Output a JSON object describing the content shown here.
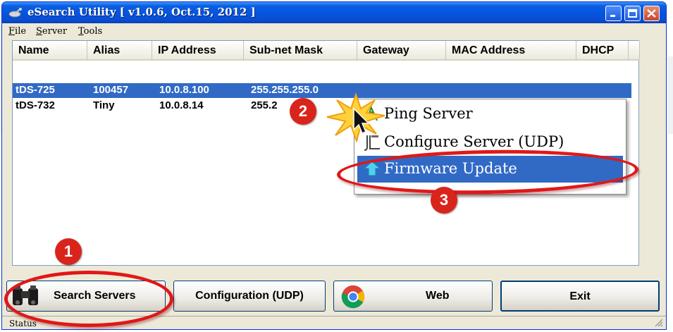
{
  "window": {
    "title": "eSearch Utility [ v1.0.6, Oct.15, 2012 ]",
    "icon": "satellite-dish-icon"
  },
  "menu": [
    {
      "label": "File",
      "accel": "F",
      "rest": "ile"
    },
    {
      "label": "Server",
      "accel": "S",
      "rest": "erver"
    },
    {
      "label": "Tools",
      "accel": "T",
      "rest": "ools"
    }
  ],
  "columns": [
    "Name",
    "Alias",
    "IP Address",
    "Sub-net Mask",
    "Gateway",
    "MAC Address",
    "DHCP"
  ],
  "rows": [
    {
      "name": "tDS-725",
      "alias": "100457",
      "ip": "10.0.8.100",
      "mask": "255.255.255.0",
      "gateway": "",
      "mac": "",
      "dhcp": "",
      "selected": true
    },
    {
      "name": "tDS-732",
      "alias": "Tiny",
      "ip": "10.0.8.14",
      "mask": "255.2",
      "gateway": "",
      "mac": "",
      "dhcp": "",
      "selected": false
    }
  ],
  "context_menu": {
    "items": [
      {
        "label": "Ping Server",
        "icon": "ping-icon"
      },
      {
        "label": "Configure Server (UDP)",
        "icon": "configure-icon"
      },
      {
        "label": "Firmware Update",
        "icon": "firmware-icon",
        "highlighted": true
      }
    ]
  },
  "buttons": {
    "search": "Search Servers",
    "configuration": "Configuration (UDP)",
    "web": "Web",
    "exit": "Exit"
  },
  "status": "Status",
  "annotations": {
    "badge1": "1",
    "badge2": "2",
    "badge3": "3",
    "color": "#d9241c"
  },
  "colors": {
    "titlebar": "#0554e0",
    "selection": "#316ac5",
    "window_face": "#ece9d8"
  }
}
